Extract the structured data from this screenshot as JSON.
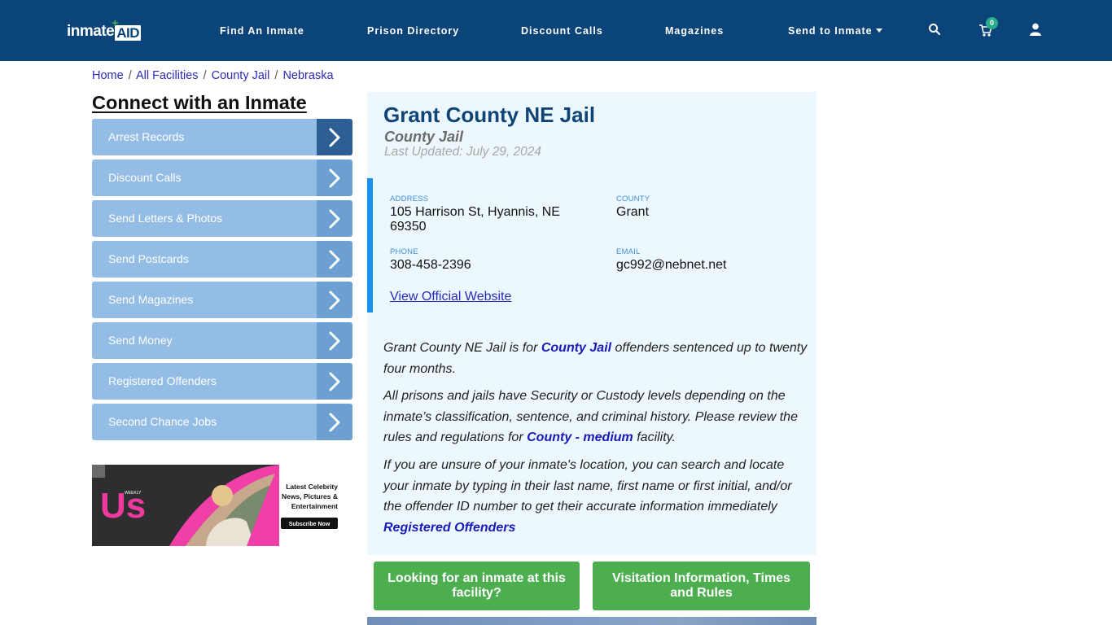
{
  "header": {
    "logo_text": "inmate",
    "logo_aid": "AID",
    "logo_plus": "+",
    "nav": [
      {
        "label": "Find An Inmate"
      },
      {
        "label": "Prison Directory"
      },
      {
        "label": "Discount Calls"
      },
      {
        "label": "Magazines"
      },
      {
        "label": "Send to Inmate",
        "has_dropdown": true
      }
    ],
    "icons": [
      "search-icon",
      "cart-icon",
      "user-icon"
    ],
    "cart_count": "0"
  },
  "breadcrumb": [
    {
      "label": "Home"
    },
    {
      "label": "All Facilities"
    },
    {
      "label": "County Jail"
    },
    {
      "label": "Nebraska"
    }
  ],
  "breadcrumb_separator": "/",
  "sidebar": {
    "title": "Connect with an Inmate",
    "items": [
      {
        "label": "Arrest Records",
        "active": true
      },
      {
        "label": "Discount Calls"
      },
      {
        "label": "Send Letters & Photos"
      },
      {
        "label": "Send Postcards"
      },
      {
        "label": "Send Magazines"
      },
      {
        "label": "Send Money"
      },
      {
        "label": "Registered Offenders"
      },
      {
        "label": "Second Chance Jobs"
      }
    ],
    "ad": {
      "brand": "Us",
      "brand_small": "WEEKLY",
      "line1": "Latest Celebrity",
      "line2": "News, Pictures &",
      "line3": "Entertainment",
      "cta": "Subscribe Now"
    }
  },
  "facility": {
    "name": "Grant County NE Jail",
    "type": "County Jail",
    "last_updated": "Last Updated: July 29, 2024",
    "address_label": "ADDRESS",
    "address_line1": "105 Harrison St, Hyannis, NE",
    "address_line2": "69350",
    "county_label": "COUNTY",
    "county": "Grant",
    "phone_label": "PHONE",
    "phone": "308-458-2396",
    "email_label": "EMAIL",
    "email": "gc992@nebnet.net",
    "website_link": "View Official Website"
  },
  "description": {
    "p1_a": "Grant County NE Jail is for ",
    "p1_link": "County Jail",
    "p1_b": " offenders sentenced up to twenty four months.",
    "p2_a": "All prisons and jails have Security or Custody levels depending on the inmate’s classification, sentence, and criminal history. Please review the rules and regulations for ",
    "p2_link": "County - medium",
    "p2_b": " facility.",
    "p3": "If you are unsure of your inmate's location, you can search and locate your inmate by typing in their last name, first name or first initial, and/or the offender ID number to get their accurate information immediately",
    "p3_link": "Registered Offenders"
  },
  "buttons": {
    "find_inmate": "Looking for an inmate at this facility?",
    "visitation": "Visitation Information, Times and Rules"
  },
  "colors": {
    "header_bg": "#0b4478",
    "sidebar_item": "#94bde6",
    "sidebar_arrow": "#6c9fd2",
    "sidebar_arrow_active": "#2e5f94",
    "panel_bg": "#edf7fe",
    "accent_bar": "#1890f0",
    "button_green": "#4cae4f",
    "link": "#1a1ab8"
  }
}
